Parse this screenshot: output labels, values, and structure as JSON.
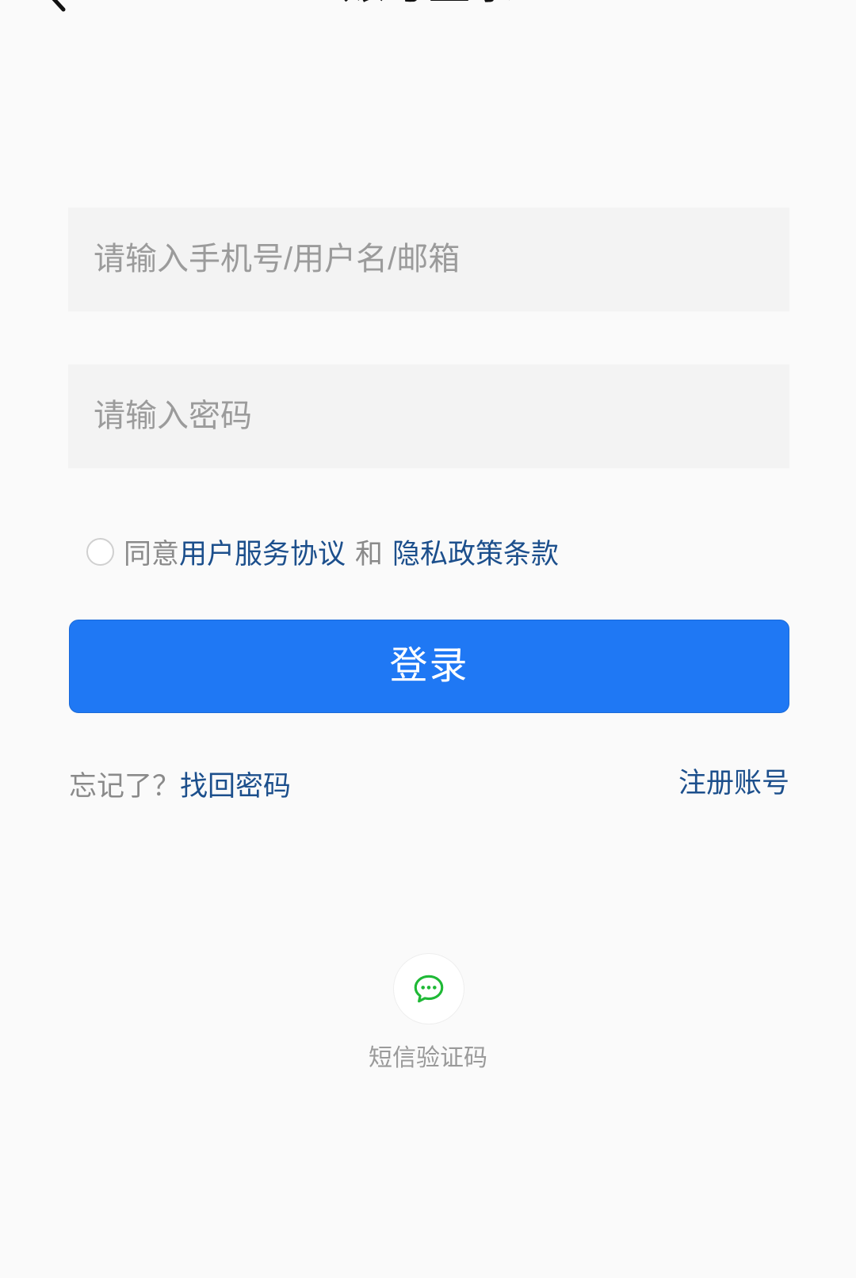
{
  "header": {
    "back_icon": "chevron-left-icon",
    "title": "账号登录"
  },
  "form": {
    "account_placeholder": "请输入手机号/用户名/邮箱",
    "password_placeholder": "请输入密码"
  },
  "agreement": {
    "checked": false,
    "prefix": "同意",
    "terms_link": "用户服务协议",
    "conjunction": "和",
    "privacy_link": "隐私政策条款"
  },
  "login_button": {
    "label": "登录"
  },
  "footer_links": {
    "forgot_prefix": "忘记了？",
    "recover_link": "找回密码",
    "register_link": "注册账号"
  },
  "alt_login": {
    "icon": "chat-bubble-icon",
    "label": "短信验证码"
  },
  "colors": {
    "background": "#fafafa",
    "input_background": "#f3f3f3",
    "primary_button": "#1f78f4",
    "link": "#1c4f8c",
    "muted_text": "#8a8a8a",
    "sms_icon": "#1fb936"
  }
}
